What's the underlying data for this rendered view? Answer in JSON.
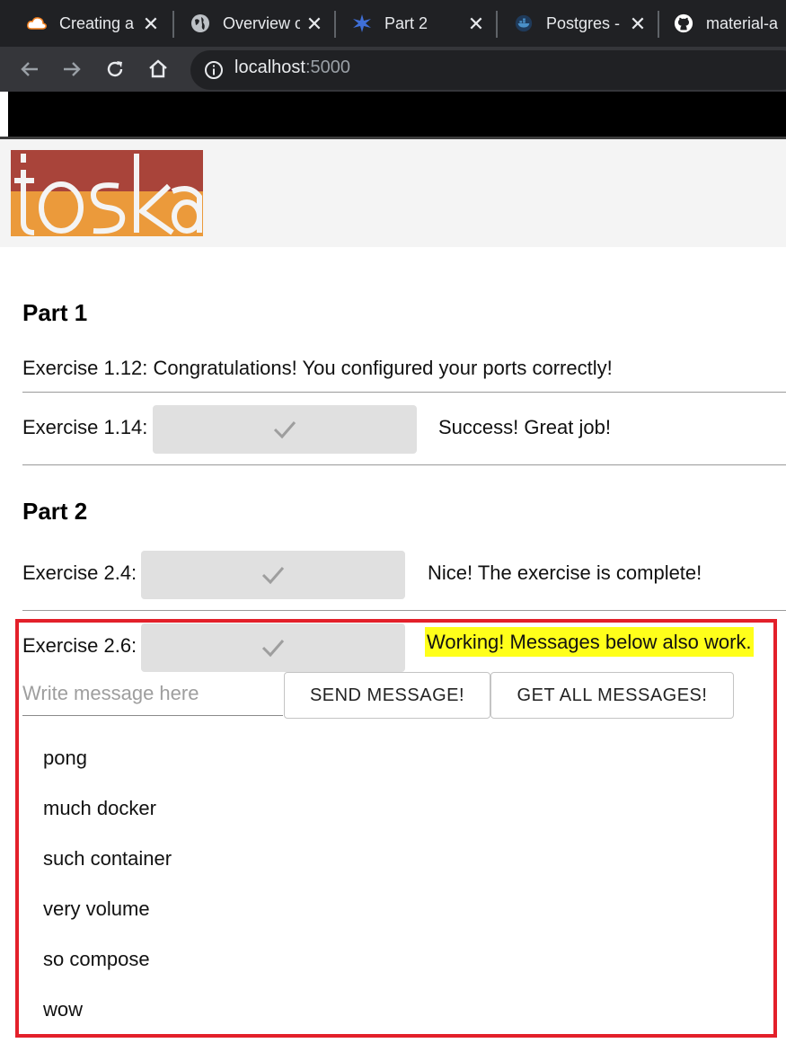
{
  "browser": {
    "tabs": [
      {
        "title": "Creating a",
        "icon": "cloud-icon"
      },
      {
        "title": "Overview o",
        "icon": "globe-icon"
      },
      {
        "title": "Part 2",
        "icon": "app-icon"
      },
      {
        "title": "Postgres -",
        "icon": "docker-icon"
      },
      {
        "title": "material-a",
        "icon": "github-icon"
      }
    ],
    "url_host": "localhost",
    "url_port": ":5000"
  },
  "logo_text": "toska",
  "part1": {
    "heading": "Part 1",
    "ex112": "Exercise 1.12: Congratulations! You configured your ports correctly!",
    "ex114_label": "Exercise 1.14:",
    "ex114_msg": "Success! Great job!"
  },
  "part2": {
    "heading": "Part 2",
    "ex24_label": "Exercise 2.4:",
    "ex24_msg": "Nice! The exercise is complete!",
    "ex26_label": "Exercise 2.6:",
    "ex26_msg": "Working! Messages below also work.",
    "input_placeholder": "Write message here",
    "send_label": "SEND MESSAGE!",
    "get_label": "GET ALL MESSAGES!",
    "messages": [
      "pong",
      "much docker",
      "such container",
      "very volume",
      "so compose",
      "wow"
    ]
  },
  "colors": {
    "highlight": "#ffff1a",
    "annotation_box": "#e3202a",
    "logo_top": "#a9443a",
    "logo_bottom": "#eb9a3b"
  }
}
